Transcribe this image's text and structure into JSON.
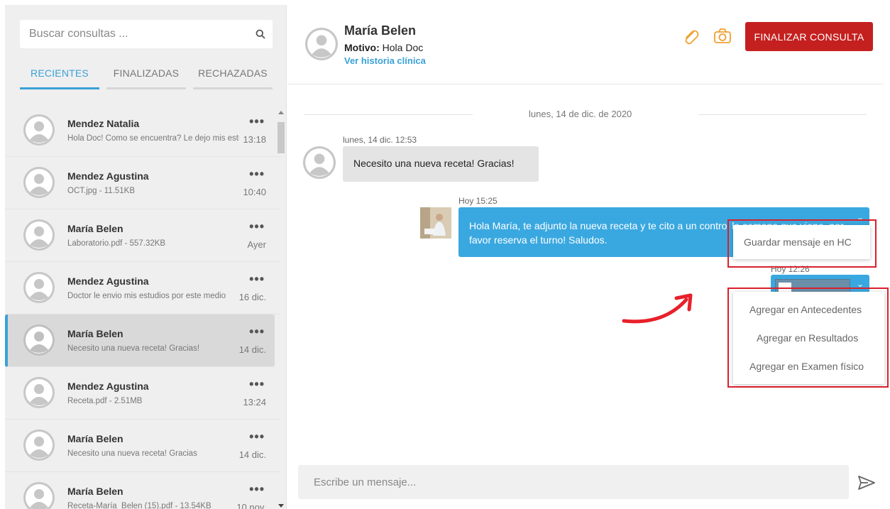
{
  "search": {
    "placeholder": "Buscar consultas ..."
  },
  "tabs": [
    {
      "label": "RECIENTES",
      "active": true
    },
    {
      "label": "FINALIZADAS",
      "active": false
    },
    {
      "label": "RECHAZADAS",
      "active": false
    }
  ],
  "conversations": [
    {
      "name": "Mendez Natalia",
      "preview": "Hola Doc! Como se encuentra? Le dejo mis estudios",
      "time": "13:18"
    },
    {
      "name": "Mendez Agustina",
      "preview": "OCT.jpg - 11.51KB",
      "time": "10:40"
    },
    {
      "name": "María Belen",
      "preview": "Laboratorio.pdf - 557.32KB",
      "time": "Ayer"
    },
    {
      "name": "Mendez Agustina",
      "preview": "Doctor le envio mis estudios por este medio",
      "time": "16 dic."
    },
    {
      "name": "María Belen",
      "preview": "Necesito una nueva receta! Gracias!",
      "time": "14 dic.",
      "selected": true
    },
    {
      "name": "Mendez Agustina",
      "preview": "Receta.pdf - 2.51MB",
      "time": "13:24"
    },
    {
      "name": "María Belen",
      "preview": "Necesito una nueva receta! Gracias",
      "time": "14 dic."
    },
    {
      "name": "María Belen",
      "preview": "Receta-María_Belen (15).pdf - 13.54KB",
      "time": "10 nov."
    }
  ],
  "more_label": "•••",
  "header": {
    "patient_name": "María Belen",
    "motivo_label": "Motivo:",
    "motivo_value": " Hola Doc",
    "history_link": "Ver historia clínica",
    "finish_button": "FINALIZAR CONSULTA"
  },
  "chat": {
    "date_separator": "lunes, 14 de dic. de 2020",
    "incoming": {
      "timestamp": "lunes, 14 dic. 12:53",
      "text": "Necesito una nueva receta! Gracias!"
    },
    "outgoing": {
      "timestamp": "Hoy 15:25",
      "text": "Hola María, te adjunto la nueva receta y te cito a un control la semana que viene, por favor reserva el turno! Saludos."
    },
    "file_message": {
      "timestamp": "Hoy 12:26"
    },
    "message_menu": {
      "option": "Guardar mensaje en HC"
    },
    "file_menu": {
      "options": [
        "Agregar en Antecedentes",
        "Agregar en Resultados",
        "Agregar en Examen físico"
      ]
    }
  },
  "composer": {
    "placeholder": "Escribe un mensaje..."
  },
  "colors": {
    "accent_blue": "#3aa1d6",
    "bubble_blue": "#3aa8e0",
    "finish_red": "#c4201f",
    "icon_orange": "#f0a030",
    "highlight_red": "#d8202c"
  }
}
